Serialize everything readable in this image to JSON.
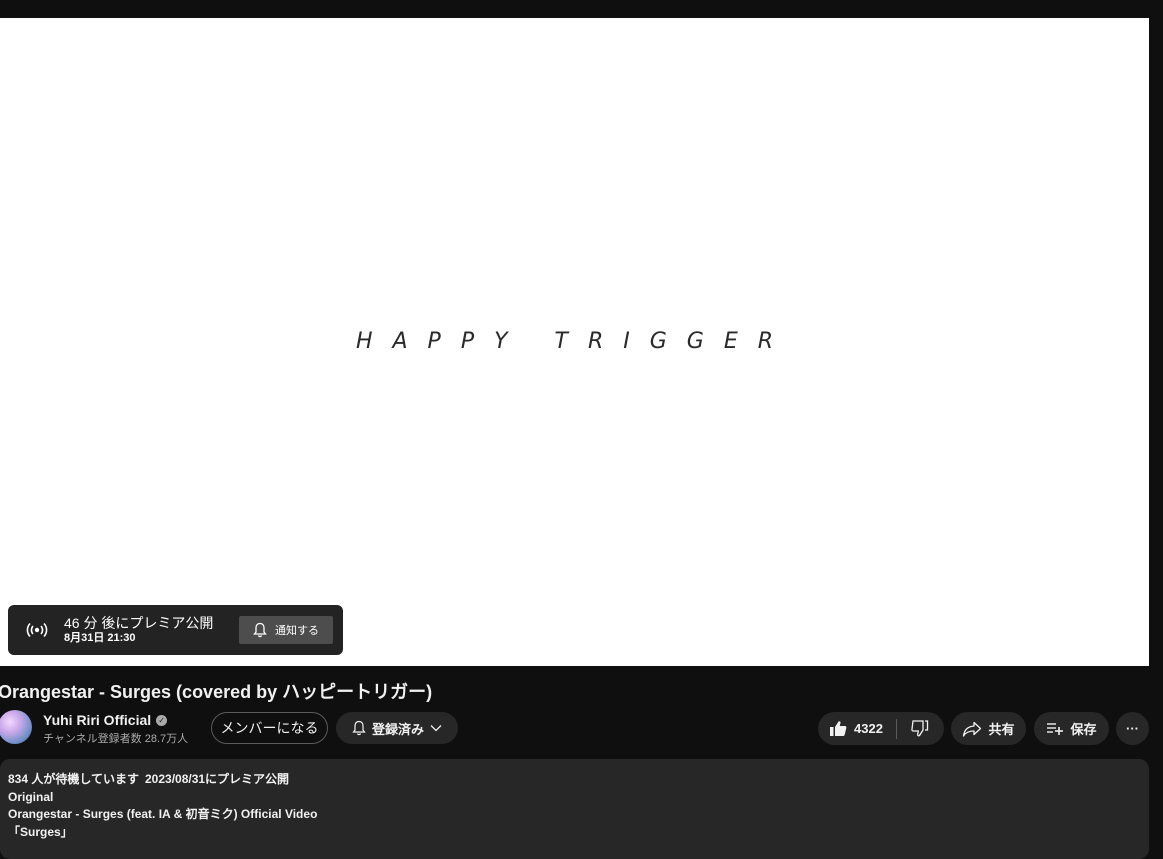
{
  "player": {
    "title_text": "HAPPY  TRIGGER",
    "premiere": {
      "main": "46 分 後にプレミア公開",
      "sub": "8月31日 21:30",
      "notify_label": "通知する"
    }
  },
  "video": {
    "title": "Orangestar - Surges (covered by ハッピートリガー)"
  },
  "channel": {
    "name": "Yuhi Riri Official",
    "subscribers": "チャンネル登録者数 28.7万人",
    "member_label": "メンバーになる",
    "subscribed_label": "登録済み"
  },
  "actions": {
    "like_count": "4322",
    "share_label": "共有",
    "save_label": "保存",
    "more_label": "···"
  },
  "description": {
    "waiting": "834 人が待機しています",
    "premiere_date": "2023/08/31にプレミア公開",
    "lines": [
      "Original",
      "Orangestar - Surges (feat. IA & 初音ミク) Official Video",
      "「Surges」"
    ]
  },
  "colors": {
    "background": "#0f0f0f",
    "pill": "#272727",
    "text": "#f1f1f1",
    "secondary_text": "#aaaaaa"
  }
}
